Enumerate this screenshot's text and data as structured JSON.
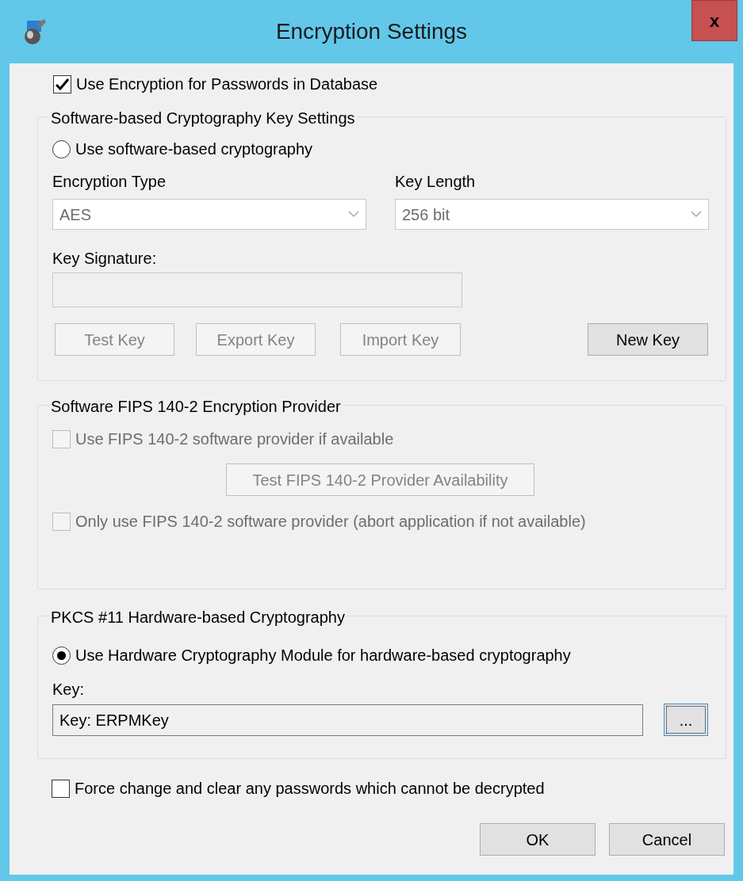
{
  "window": {
    "title": "Encryption Settings",
    "close_label": "x"
  },
  "use_encryption": {
    "label": "Use Encryption for Passwords in Database",
    "checked": true
  },
  "software_group": {
    "title": "Software-based Cryptography Key Settings",
    "radio": {
      "label": "Use software-based cryptography",
      "selected": false
    },
    "encryption_type": {
      "label": "Encryption Type",
      "value": "AES",
      "disabled": true
    },
    "key_length": {
      "label": "Key Length",
      "value": "256 bit",
      "disabled": true
    },
    "key_signature": {
      "label": "Key Signature:",
      "disabled": true
    },
    "buttons": [
      {
        "label": "Test Key",
        "disabled": true
      },
      {
        "label": "Export Key",
        "disabled": true
      },
      {
        "label": "Import Key",
        "disabled": true
      },
      {
        "label": "New Key",
        "disabled": false
      }
    ]
  },
  "fips_group": {
    "title": "Software FIPS 140-2 Encryption Provider",
    "checkboxes": [
      {
        "label": "Use FIPS 140-2 software provider if available",
        "checked": false,
        "disabled": true
      },
      {
        "label": "Only use FIPS 140-2 software provider (abort application if not available)",
        "checked": false,
        "disabled": true
      }
    ],
    "test_button": {
      "label": "Test FIPS 140-2 Provider Availability",
      "disabled": true
    }
  },
  "hardware_group": {
    "title": "PKCS #11 Hardware-based Cryptography",
    "radio": {
      "label": "Use Hardware Cryptography Module for hardware-based cryptography",
      "selected": true
    },
    "key_label": "Key:",
    "key_value": "Key: ERPMKey",
    "browse_label": "..."
  },
  "force_change": {
    "label": "Force change and clear any passwords which cannot be decrypted",
    "checked": false
  },
  "buttons": [
    {
      "label": "OK"
    },
    {
      "label": "Cancel"
    }
  ]
}
